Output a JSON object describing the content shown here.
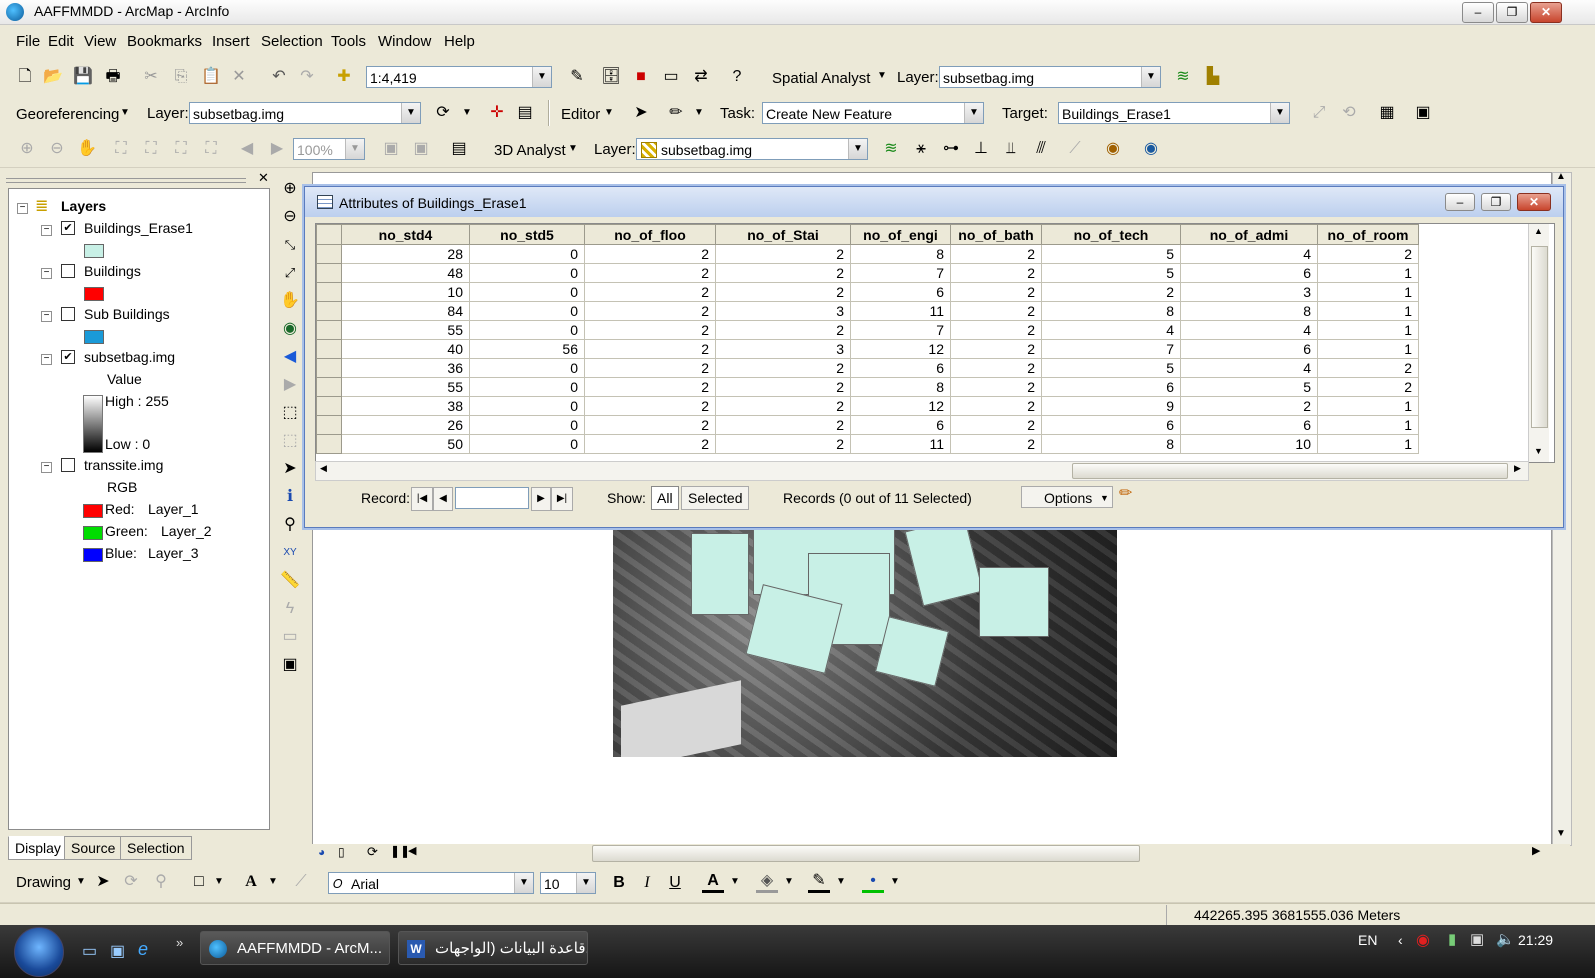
{
  "window": {
    "title": "AAFFMMDD - ArcMap - ArcInfo"
  },
  "menu": [
    "File",
    "Edit",
    "View",
    "Bookmarks",
    "Insert",
    "Selection",
    "Tools",
    "Window",
    "Help"
  ],
  "toolbar1": {
    "scale": "1:4,419",
    "spatial_analyst_label": "Spatial Analyst",
    "layer_label": "Layer:",
    "layer_value": "subsetbag.img"
  },
  "toolbar2": {
    "georef_label": "Georeferencing",
    "layer_label": "Layer:",
    "layer_value": "subsetbag.img",
    "editor_label": "Editor",
    "task_label": "Task:",
    "task_value": "Create New Feature",
    "target_label": "Target:",
    "target_value": "Buildings_Erase1"
  },
  "toolbar3": {
    "zoom": "100%",
    "analyst_label": "3D Analyst",
    "layer_label": "Layer:",
    "layer_value": "subsetbag.img"
  },
  "toc": {
    "root": "Layers",
    "layers": [
      {
        "name": "Buildings_Erase1",
        "checked": true
      },
      {
        "name": "Buildings",
        "checked": false
      },
      {
        "name": "Sub Buildings",
        "checked": false
      },
      {
        "name": "subsetbag.img",
        "checked": true
      },
      {
        "name": "transsite.img",
        "checked": false
      }
    ],
    "raster": {
      "value_label": "Value",
      "high": "High : 255",
      "low": "Low : 0"
    },
    "rgb": {
      "label": "RGB",
      "red": "Red:",
      "red_layer": "Layer_1",
      "green": "Green:",
      "green_layer": "Layer_2",
      "blue": "Blue:",
      "blue_layer": "Layer_3"
    },
    "tabs": [
      "Display",
      "Source",
      "Selection"
    ],
    "colors": {
      "buildings_erase1": "#c8f0e6",
      "buildings": "#ff0000",
      "sub_buildings": "#1a9ad8",
      "red": "#ff0000",
      "green": "#00dd00",
      "blue": "#0000ff"
    }
  },
  "attributes": {
    "title": "Attributes of Buildings_Erase1",
    "columns": [
      "no_std4",
      "no_std5",
      "no_of_floo",
      "no_of_Stai",
      "no_of_engi",
      "no_of_bath",
      "no_of_tech",
      "no_of_admi",
      "no_of_room"
    ],
    "rows": [
      [
        "28",
        "0",
        "2",
        "2",
        "8",
        "2",
        "5",
        "4",
        "2"
      ],
      [
        "48",
        "0",
        "2",
        "2",
        "7",
        "2",
        "5",
        "6",
        "1"
      ],
      [
        "10",
        "0",
        "2",
        "2",
        "6",
        "2",
        "2",
        "3",
        "1"
      ],
      [
        "84",
        "0",
        "2",
        "3",
        "11",
        "2",
        "8",
        "8",
        "1"
      ],
      [
        "55",
        "0",
        "2",
        "2",
        "7",
        "2",
        "4",
        "4",
        "1"
      ],
      [
        "40",
        "56",
        "2",
        "3",
        "12",
        "2",
        "7",
        "6",
        "1"
      ],
      [
        "36",
        "0",
        "2",
        "2",
        "6",
        "2",
        "5",
        "4",
        "2"
      ],
      [
        "55",
        "0",
        "2",
        "2",
        "8",
        "2",
        "6",
        "5",
        "2"
      ],
      [
        "38",
        "0",
        "2",
        "2",
        "12",
        "2",
        "9",
        "2",
        "1"
      ],
      [
        "26",
        "0",
        "2",
        "2",
        "6",
        "2",
        "6",
        "6",
        "1"
      ],
      [
        "50",
        "0",
        "2",
        "2",
        "11",
        "2",
        "8",
        "10",
        "1"
      ]
    ],
    "record_label": "Record:",
    "show_label": "Show:",
    "all_label": "All",
    "selected_label": "Selected",
    "records_text": "Records (0 out of 11 Selected)",
    "options_label": "Options"
  },
  "drawing": {
    "label": "Drawing",
    "font": "Arial",
    "size": "10",
    "bold": "B",
    "italic": "I",
    "underline": "U",
    "fontcolor": "A"
  },
  "status": {
    "coords": "442265.395  3681555.036 Meters"
  },
  "taskbar": {
    "items": [
      "AAFFMMDD - ArcM...",
      "قاعدة البيانات (الواجهات..."
    ],
    "lang": "EN",
    "time": "21:29"
  }
}
